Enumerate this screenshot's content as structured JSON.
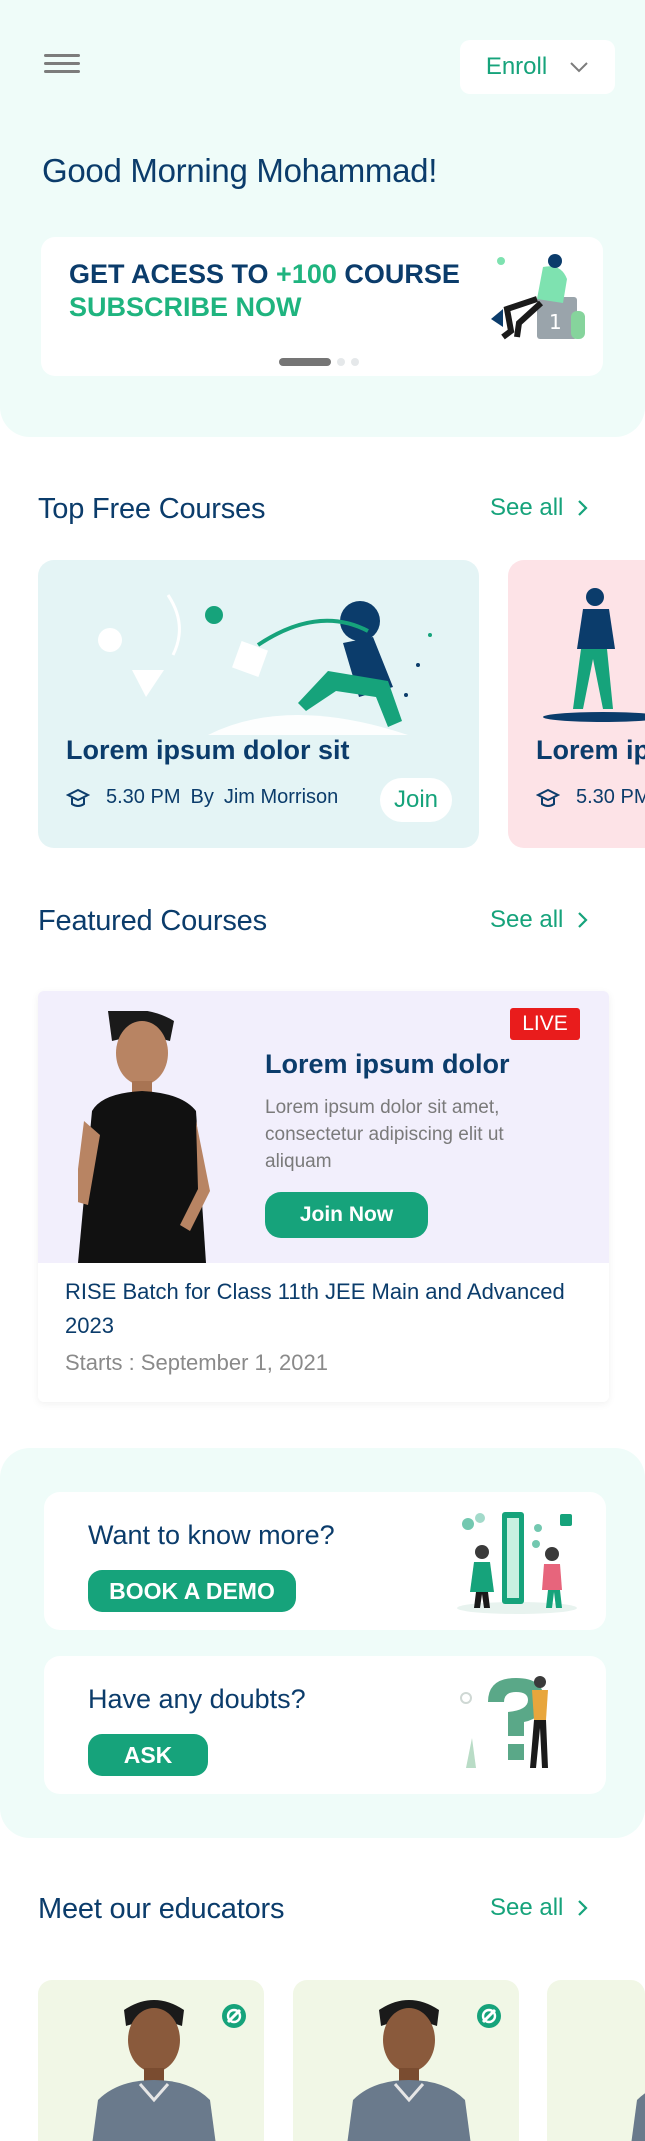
{
  "header": {
    "enroll_label": "Enroll",
    "greeting": "Good Morning Mohammad!"
  },
  "banner": {
    "line1_prefix": "GET ACESS TO ",
    "line1_highlight": "+100",
    "line1_suffix": " COURSE",
    "line2": "SUBSCRIBE NOW",
    "dots_total": 3,
    "dots_active": 1
  },
  "top_free": {
    "title": "Top Free Courses",
    "see_all": "See all",
    "courses": [
      {
        "title": "Lorem ipsum dolor sit",
        "time": "5.30 PM",
        "by": "By",
        "author": "Jim Morrison",
        "join": "Join"
      },
      {
        "title": "Lorem ipsum dolor sit",
        "time": "5.30 PM"
      }
    ]
  },
  "featured": {
    "title": "Featured Courses",
    "see_all": "See all",
    "badge": "LIVE",
    "course_title": "Lorem ipsum dolor",
    "description": "Lorem ipsum dolor sit amet, consectetur adipiscing elit ut aliquam",
    "join_now": "Join Now",
    "batch": "RISE Batch for Class 11th JEE Main and Advanced 2023",
    "starts": "Starts : September 1, 2021"
  },
  "cta": {
    "demo_question": "Want to know more?",
    "demo_button": "BOOK A DEMO",
    "doubt_question": "Have any doubts?",
    "doubt_button": "ASK"
  },
  "educators": {
    "title": "Meet our educators",
    "see_all": "See all"
  },
  "colors": {
    "navy": "#0b3c6b",
    "green": "#16a37b",
    "hero_bg": "#effcf9",
    "live_red": "#e91c1c"
  }
}
